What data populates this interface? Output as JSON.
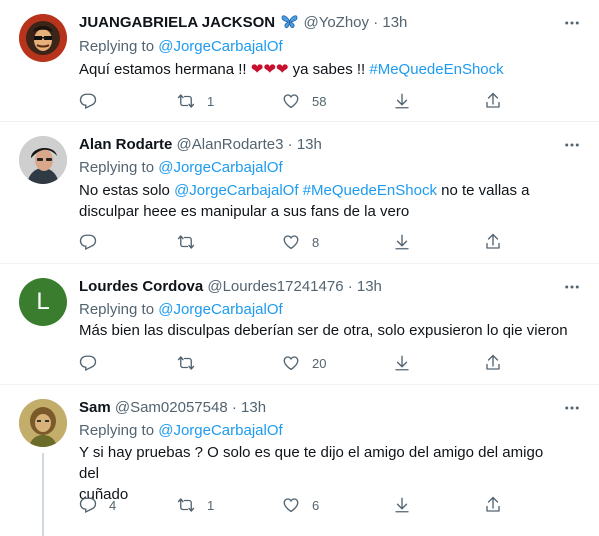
{
  "tweets": [
    {
      "name": "JUANGABRIELA JACKSON",
      "handle": "@YoZhoy",
      "time": "13h",
      "replying_prefix": "Replying to",
      "replying_to": "@JorgeCarbajalOf",
      "text_1": "Aquí estamos hermana !!",
      "text_2": "ya sabes !!",
      "hashtag": "#MeQuedeEnShock",
      "retweets": "1",
      "likes": "58",
      "replies": ""
    },
    {
      "name": "Alan Rodarte",
      "handle": "@AlanRodarte3",
      "time": "13h",
      "replying_prefix": "Replying to",
      "replying_to": "@JorgeCarbajalOf",
      "text_1": "No estas solo",
      "mention": "@JorgeCarbajalOf",
      "hashtag": "#MeQuedeEnShock",
      "text_2": "no te vallas a",
      "text_3": "disculpar heee es manipular a sus fans de la vero",
      "likes": "8"
    },
    {
      "name": "Lourdes Cordova",
      "handle": "@Lourdes17241476",
      "time": "13h",
      "avatar_letter": "L",
      "replying_prefix": "Replying to",
      "replying_to": "@JorgeCarbajalOf",
      "text": "Más bien las disculpas deberían ser de otra, solo expusieron lo qie vieron",
      "likes": "20"
    },
    {
      "name": "Sam",
      "handle": "@Sam02057548",
      "time": "13h",
      "replying_prefix": "Replying to",
      "replying_to": "@JorgeCarbajalOf",
      "text_1": "Y si hay pruebas ? O solo es que te dijo el amigo del amigo del amigo del",
      "text_2": "cuñado",
      "replies": "4",
      "retweets": "1",
      "likes": "6"
    }
  ],
  "icons": {
    "reply": "reply-icon",
    "retweet": "retweet-icon",
    "like": "heart-icon",
    "download": "download-icon",
    "share": "share-icon",
    "more": "more-icon",
    "verified_badge": "butterfly-emoji",
    "heart_emoji": "red-heart-emoji"
  },
  "colors": {
    "link": "#1d9bf0",
    "muted": "#536471",
    "heart_emoji": "#c8102e",
    "avatar_lourdes": "#3a7d2e"
  }
}
